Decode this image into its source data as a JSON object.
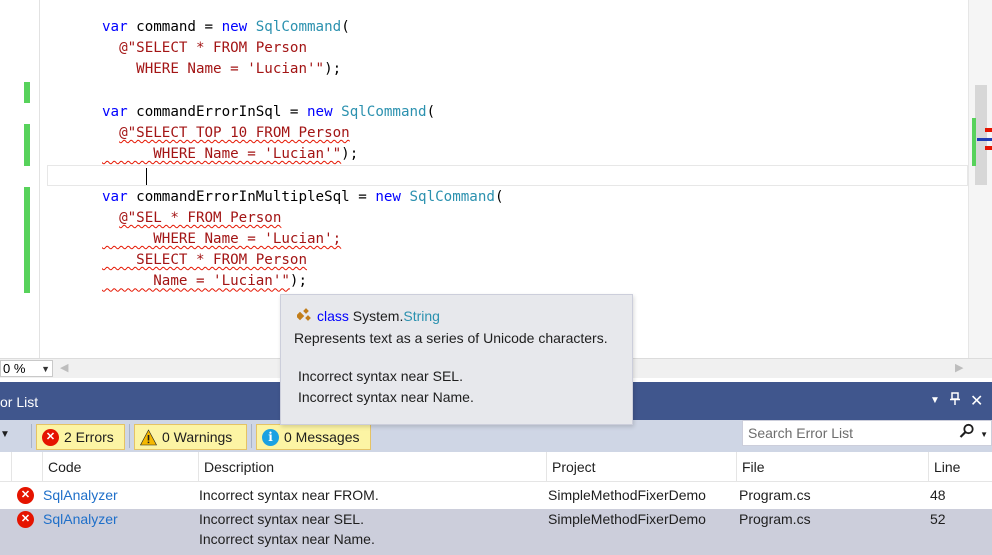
{
  "editor": {
    "lines": [
      [
        {
          "t": "var",
          "c": "kw"
        },
        {
          "t": " command = "
        },
        {
          "t": "new",
          "c": "kw"
        },
        {
          "t": " "
        },
        {
          "t": "SqlCommand",
          "c": "ty"
        },
        {
          "t": "("
        }
      ],
      [
        {
          "t": "  "
        },
        {
          "t": "@\"SELECT * FROM Person",
          "c": "st"
        }
      ],
      [
        {
          "t": "    "
        },
        {
          "t": "WHERE Name = 'Lucian'\"",
          "c": "st"
        },
        {
          "t": ");"
        }
      ],
      [],
      [
        {
          "t": "var",
          "c": "kw"
        },
        {
          "t": " commandErrorInSql = "
        },
        {
          "t": "new",
          "c": "kw"
        },
        {
          "t": " "
        },
        {
          "t": "SqlCommand",
          "c": "ty"
        },
        {
          "t": "("
        }
      ],
      [
        {
          "t": "  "
        },
        {
          "t": "@\"SELECT TOP 10 FROM Person",
          "c": "st squig"
        }
      ],
      [
        {
          "t": "      WHERE Name = 'Lucian'\"",
          "c": "st squig"
        },
        {
          "t": ");"
        }
      ],
      [
        {
          "t": "     "
        },
        {
          "t": "",
          "c": "caret"
        }
      ],
      [
        {
          "t": "var",
          "c": "kw"
        },
        {
          "t": " commandErrorInMultipleSql = "
        },
        {
          "t": "new",
          "c": "kw"
        },
        {
          "t": " "
        },
        {
          "t": "SqlCommand",
          "c": "ty"
        },
        {
          "t": "("
        }
      ],
      [
        {
          "t": "  "
        },
        {
          "t": "@\"SEL * FROM Person",
          "c": "st squig"
        }
      ],
      [
        {
          "t": "      WHERE Name = 'Lucian';",
          "c": "st squig"
        }
      ],
      [
        {
          "t": "    SELECT * FROM Person",
          "c": "st squig"
        }
      ],
      [
        {
          "t": "      Name = 'Lucian'\"",
          "c": "st squig"
        },
        {
          "t": ");"
        }
      ]
    ],
    "zoom": "0 %"
  },
  "tooltip": {
    "keyword": "class",
    "ns": "System.",
    "type": "String",
    "description": "Represents text as a series of Unicode characters.",
    "error1": "Incorrect syntax near SEL.",
    "error2": "Incorrect syntax near Name."
  },
  "error_list": {
    "title": "or List",
    "errors_label": "2 Errors",
    "warnings_label": "0 Warnings",
    "messages_label": "0 Messages",
    "search_placeholder": "Search Error List",
    "columns": {
      "code": "Code",
      "description": "Description",
      "project": "Project",
      "file": "File",
      "line": "Line"
    },
    "rows": [
      {
        "code": "SqlAnalyzer",
        "description": "Incorrect syntax near FROM.",
        "description2": "",
        "project": "SimpleMethodFixerDemo",
        "file": "Program.cs",
        "line": "48"
      },
      {
        "code": "SqlAnalyzer",
        "description": "Incorrect syntax near SEL.",
        "description2": "Incorrect syntax near Name.",
        "project": "SimpleMethodFixerDemo",
        "file": "Program.cs",
        "line": "52"
      }
    ],
    "colors": {
      "title_bar": "#40568d",
      "toolbar": "#cfd6e5",
      "selected_row": "#cccedb",
      "error_red": "#e51400",
      "filter_active": "#fcf4a4"
    }
  }
}
